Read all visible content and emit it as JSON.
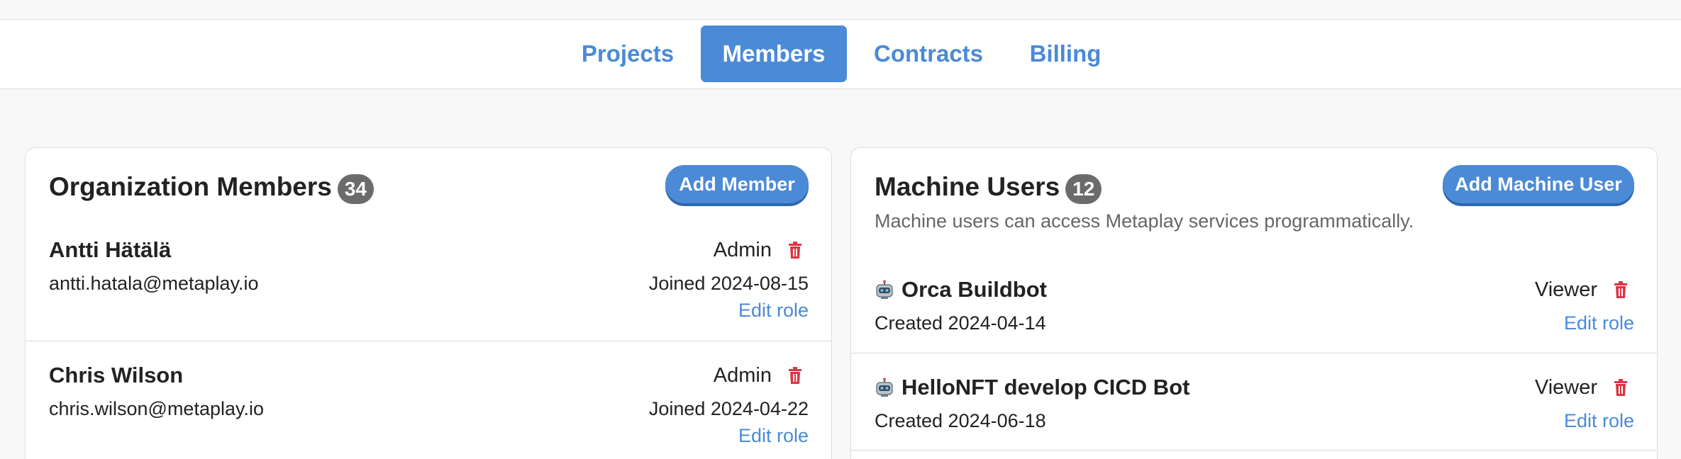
{
  "tabs": [
    {
      "label": "Projects",
      "active": false
    },
    {
      "label": "Members",
      "active": true
    },
    {
      "label": "Contracts",
      "active": false
    },
    {
      "label": "Billing",
      "active": false
    }
  ],
  "org_members": {
    "title": "Organization Members",
    "count": "34",
    "add_button": "Add Member",
    "members": [
      {
        "name": "Antti Hätälä",
        "email": "antti.hatala@metaplay.io",
        "role": "Admin",
        "joined": "Joined 2024-08-15",
        "edit": "Edit role"
      },
      {
        "name": "Chris Wilson",
        "email": "chris.wilson@metaplay.io",
        "role": "Admin",
        "joined": "Joined 2024-04-22",
        "edit": "Edit role"
      }
    ]
  },
  "machine_users": {
    "title": "Machine Users",
    "count": "12",
    "add_button": "Add Machine User",
    "description": "Machine users can access Metaplay services programmatically.",
    "users": [
      {
        "name": "Orca Buildbot",
        "created": "Created 2024-04-14",
        "role": "Viewer",
        "edit": "Edit role",
        "icon": "robot-icon"
      },
      {
        "name": "HelloNFT develop CICD Bot",
        "created": "Created 2024-06-18",
        "role": "Viewer",
        "edit": "Edit role",
        "icon": "robot-icon"
      }
    ]
  },
  "colors": {
    "accent": "#4b8ad7",
    "link": "#4a8ad8",
    "danger": "#dc3545",
    "badge": "#6b6b6b"
  }
}
